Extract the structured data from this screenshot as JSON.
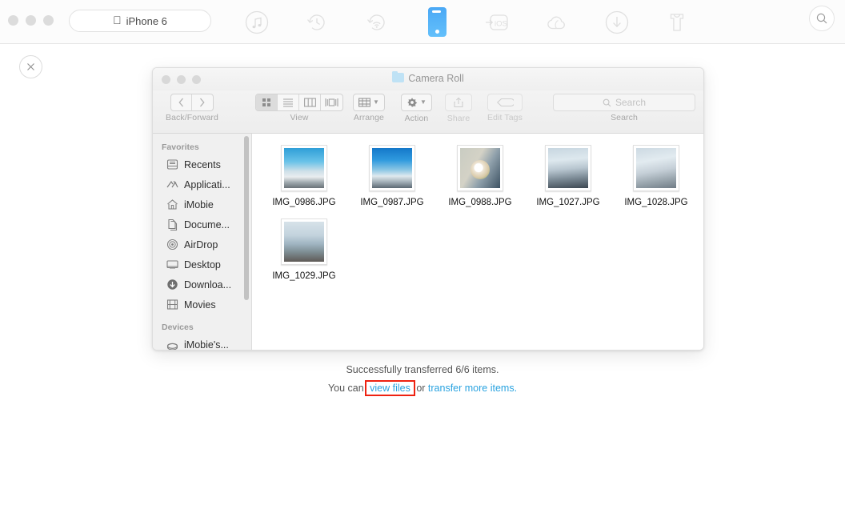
{
  "appbar": {
    "device_label": "iPhone 6",
    "apple_glyph": "",
    "tools": [
      {
        "name": "music-icon",
        "label": "Music"
      },
      {
        "name": "backup-restore-icon",
        "label": "Backup Restore"
      },
      {
        "name": "airbackup-icon",
        "label": "AirBackup"
      },
      {
        "name": "device-manager-icon",
        "label": "Device Manager",
        "active": true
      },
      {
        "name": "to-ios-icon",
        "label": "iOS Mover"
      },
      {
        "name": "icloud-manager-icon",
        "label": "iCloud Manager"
      },
      {
        "name": "downloader-icon",
        "label": "Downloader"
      },
      {
        "name": "cleaner-icon",
        "label": "Cleaner"
      }
    ],
    "search_icon": "search-icon",
    "close_icon": "close-icon"
  },
  "finder": {
    "title": "Camera Roll",
    "folder_icon": "folder-icon",
    "toolbar": {
      "back_forward_label": "Back/Forward",
      "back_glyph": "‹",
      "forward_glyph": "›",
      "view_label": "View",
      "view_modes": [
        "icon-view",
        "list-view",
        "column-view",
        "coverflow-view"
      ],
      "view_selected_index": 0,
      "arrange_label": "Arrange",
      "action_label": "Action",
      "share_label": "Share",
      "edit_tags_label": "Edit Tags",
      "search_label": "Search",
      "search_placeholder": "Search",
      "search_value": ""
    },
    "sidebar": {
      "sections": [
        {
          "heading": "Favorites",
          "items": [
            {
              "label": "Recents",
              "icon": "recents-icon"
            },
            {
              "label": "Applicati...",
              "icon": "applications-icon"
            },
            {
              "label": "iMobie",
              "icon": "home-icon"
            },
            {
              "label": "Docume...",
              "icon": "documents-icon"
            },
            {
              "label": "AirDrop",
              "icon": "airdrop-icon"
            },
            {
              "label": "Desktop",
              "icon": "desktop-icon"
            },
            {
              "label": "Downloa...",
              "icon": "downloads-icon"
            },
            {
              "label": "Movies",
              "icon": "movies-icon"
            }
          ]
        },
        {
          "heading": "Devices",
          "items": [
            {
              "label": "iMobie's...",
              "icon": "disk-icon"
            }
          ]
        }
      ]
    },
    "files": [
      {
        "name": "IMG_0986.JPG",
        "art": "img-sky1"
      },
      {
        "name": "IMG_0987.JPG",
        "art": "img-sky2"
      },
      {
        "name": "IMG_0988.JPG",
        "art": "img-coco"
      },
      {
        "name": "IMG_1027.JPG",
        "art": "img-beach1"
      },
      {
        "name": "IMG_1028.JPG",
        "art": "img-beach2"
      },
      {
        "name": "IMG_1029.JPG",
        "art": "img-rock"
      }
    ]
  },
  "status": {
    "line1": "Successfully transferred 6/6 items.",
    "line2_prefix": "You can ",
    "view_files_link": "view files",
    "line2_middle": " or ",
    "transfer_more_link": "transfer more items.",
    "line2_suffix": ""
  },
  "colors": {
    "accent": "#2aa3e0",
    "highlight_box": "#ee2211",
    "device_active": "#4aa8f5"
  }
}
